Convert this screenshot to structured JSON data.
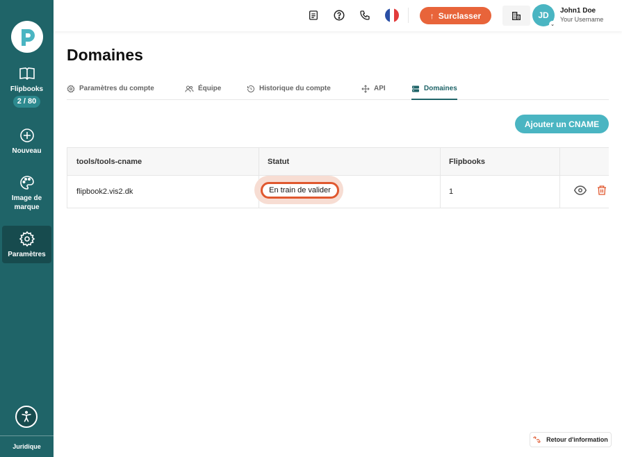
{
  "sidebar": {
    "items": [
      {
        "label": "Flipbooks",
        "badge": "2 / 80",
        "icon": "book-open-icon"
      },
      {
        "label": "Nouveau",
        "icon": "plus-circle-icon"
      },
      {
        "label": "Image de marque",
        "icon": "palette-icon"
      },
      {
        "label": "Paramètres",
        "icon": "gear-icon"
      }
    ],
    "legal": "Juridique"
  },
  "topbar": {
    "upgrade_label": "Surclasser",
    "avatar_initials": "JD",
    "user_name": "John1 Doe",
    "user_sub": "Your Username"
  },
  "page": {
    "title": "Domaines",
    "tabs": [
      {
        "label": "Paramètres du compte"
      },
      {
        "label": "Équipe"
      },
      {
        "label": "Historique du compte"
      },
      {
        "label": "API"
      },
      {
        "label": "Domaines"
      }
    ],
    "add_button": "Ajouter un CNAME"
  },
  "table": {
    "headers": [
      "tools/tools-cname",
      "Statut",
      "Flipbooks"
    ],
    "rows": [
      {
        "domain": "flipbook2.vis2.dk",
        "status": "En train de valider",
        "flipbooks": "1"
      }
    ]
  },
  "feedback_label": "Retour d'information",
  "colors": {
    "sidebar": "#1f6468",
    "accent": "#e8643a",
    "teal": "#4ab5c2"
  }
}
